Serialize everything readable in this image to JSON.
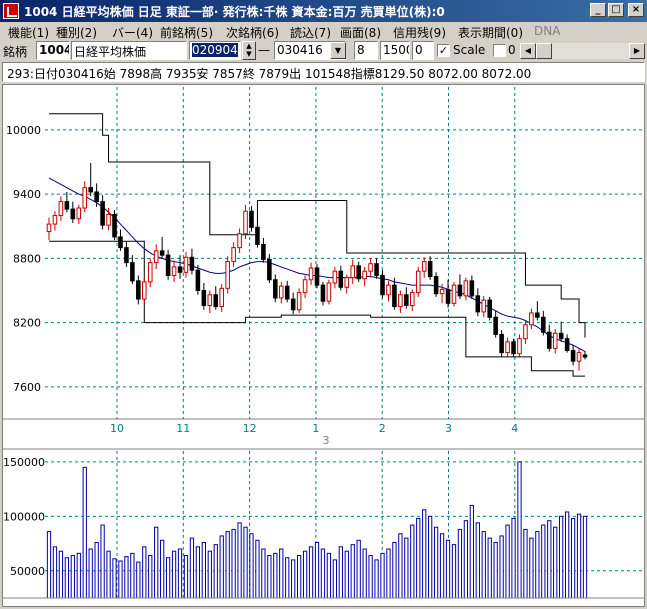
{
  "window": {
    "title": "1004 日経平均株価  日足  東証一部·  発行株:千株  資本金:百万  売買単位(株):0",
    "buttons": {
      "minimize": "_",
      "maximize": "□",
      "close": "×"
    }
  },
  "menu": [
    {
      "label": "機能(1)"
    },
    {
      "label": "種別(2)"
    },
    {
      "label": "バー(4)"
    },
    {
      "label": "前銘柄(5)"
    },
    {
      "label": "次銘柄(6)"
    },
    {
      "label": "読込(7)"
    },
    {
      "label": "画面(8)"
    },
    {
      "label": "信用残(9)"
    },
    {
      "label": "表示期間(0)"
    },
    {
      "label": "DNA",
      "disabled": true
    }
  ],
  "toolbar": {
    "symbol_label": "銘柄",
    "code_value": "1004",
    "name_value": "日経平均株価",
    "start_date": "020904",
    "dash": "—",
    "end_date": "030416",
    "period_value": "8",
    "count_value": "1500",
    "offset_value": "0",
    "scale_label": "Scale",
    "scale_checked": true,
    "extra_checked": false,
    "extra_value": "0"
  },
  "info": {
    "text": "293:日付030416始 7898高 7935安 7857終 7879出 101548指標8129.50  8072.00  8072.00"
  },
  "chart_data": {
    "type": "candlestick",
    "price_axis": {
      "ticks": [
        10000,
        9400,
        8800,
        8200,
        7600
      ],
      "ylim": [
        7300,
        10400
      ]
    },
    "volume_axis": {
      "ticks": [
        150000,
        100000,
        50000
      ],
      "ylim": [
        25000,
        160000
      ]
    },
    "x_month_labels": [
      "10",
      "11",
      "12",
      "1",
      "2",
      "3",
      "4"
    ],
    "x_year_label": "3",
    "colors": {
      "up": "#cc0000",
      "down": "#000000",
      "grid": "#008080",
      "envelope": "#000000",
      "average": "#000080",
      "volume": "#0000aa"
    },
    "candles": [
      {
        "o": 9050,
        "h": 9180,
        "l": 8970,
        "c": 9120
      },
      {
        "o": 9120,
        "h": 9240,
        "l": 9060,
        "c": 9200
      },
      {
        "o": 9200,
        "h": 9380,
        "l": 9150,
        "c": 9330
      },
      {
        "o": 9330,
        "h": 9420,
        "l": 9230,
        "c": 9260
      },
      {
        "o": 9260,
        "h": 9330,
        "l": 9130,
        "c": 9170
      },
      {
        "o": 9170,
        "h": 9300,
        "l": 9120,
        "c": 9270
      },
      {
        "o": 9270,
        "h": 9520,
        "l": 9230,
        "c": 9460
      },
      {
        "o": 9460,
        "h": 9690,
        "l": 9380,
        "c": 9420
      },
      {
        "o": 9420,
        "h": 9500,
        "l": 9280,
        "c": 9330
      },
      {
        "o": 9330,
        "h": 9390,
        "l": 9070,
        "c": 9110
      },
      {
        "o": 9110,
        "h": 9270,
        "l": 9060,
        "c": 9210
      },
      {
        "o": 9210,
        "h": 9250,
        "l": 8970,
        "c": 9000
      },
      {
        "o": 9000,
        "h": 9070,
        "l": 8870,
        "c": 8900
      },
      {
        "o": 8900,
        "h": 8960,
        "l": 8720,
        "c": 8760
      },
      {
        "o": 8760,
        "h": 8830,
        "l": 8560,
        "c": 8590
      },
      {
        "o": 8590,
        "h": 8640,
        "l": 8370,
        "c": 8420
      },
      {
        "o": 8420,
        "h": 8620,
        "l": 8380,
        "c": 8580
      },
      {
        "o": 8580,
        "h": 8800,
        "l": 8530,
        "c": 8760
      },
      {
        "o": 8760,
        "h": 8930,
        "l": 8700,
        "c": 8870
      },
      {
        "o": 8870,
        "h": 9000,
        "l": 8800,
        "c": 8830
      },
      {
        "o": 8830,
        "h": 8880,
        "l": 8600,
        "c": 8640
      },
      {
        "o": 8640,
        "h": 8780,
        "l": 8580,
        "c": 8720
      },
      {
        "o": 8720,
        "h": 8830,
        "l": 8610,
        "c": 8670
      },
      {
        "o": 8670,
        "h": 8860,
        "l": 8620,
        "c": 8810
      },
      {
        "o": 8810,
        "h": 8890,
        "l": 8650,
        "c": 8690
      },
      {
        "o": 8690,
        "h": 8740,
        "l": 8460,
        "c": 8500
      },
      {
        "o": 8500,
        "h": 8570,
        "l": 8320,
        "c": 8360
      },
      {
        "o": 8360,
        "h": 8500,
        "l": 8290,
        "c": 8460
      },
      {
        "o": 8460,
        "h": 8540,
        "l": 8320,
        "c": 8350
      },
      {
        "o": 8350,
        "h": 8560,
        "l": 8300,
        "c": 8520
      },
      {
        "o": 8520,
        "h": 8820,
        "l": 8470,
        "c": 8770
      },
      {
        "o": 8770,
        "h": 8950,
        "l": 8720,
        "c": 8900
      },
      {
        "o": 8900,
        "h": 9080,
        "l": 8850,
        "c": 9030
      },
      {
        "o": 9030,
        "h": 9300,
        "l": 8980,
        "c": 9240
      },
      {
        "o": 9240,
        "h": 9290,
        "l": 9050,
        "c": 9090
      },
      {
        "o": 9090,
        "h": 9130,
        "l": 8900,
        "c": 8930
      },
      {
        "o": 8930,
        "h": 8990,
        "l": 8760,
        "c": 8790
      },
      {
        "o": 8790,
        "h": 8840,
        "l": 8570,
        "c": 8600
      },
      {
        "o": 8600,
        "h": 8650,
        "l": 8390,
        "c": 8430
      },
      {
        "o": 8430,
        "h": 8580,
        "l": 8380,
        "c": 8540
      },
      {
        "o": 8540,
        "h": 8590,
        "l": 8390,
        "c": 8420
      },
      {
        "o": 8420,
        "h": 8480,
        "l": 8280,
        "c": 8320
      },
      {
        "o": 8320,
        "h": 8520,
        "l": 8290,
        "c": 8480
      },
      {
        "o": 8480,
        "h": 8640,
        "l": 8430,
        "c": 8600
      },
      {
        "o": 8600,
        "h": 8760,
        "l": 8550,
        "c": 8710
      },
      {
        "o": 8710,
        "h": 8750,
        "l": 8520,
        "c": 8550
      },
      {
        "o": 8550,
        "h": 8580,
        "l": 8360,
        "c": 8400
      },
      {
        "o": 8400,
        "h": 8600,
        "l": 8370,
        "c": 8570
      },
      {
        "o": 8570,
        "h": 8720,
        "l": 8520,
        "c": 8680
      },
      {
        "o": 8680,
        "h": 8730,
        "l": 8500,
        "c": 8530
      },
      {
        "o": 8530,
        "h": 8650,
        "l": 8470,
        "c": 8620
      },
      {
        "o": 8620,
        "h": 8790,
        "l": 8560,
        "c": 8730
      },
      {
        "o": 8730,
        "h": 8770,
        "l": 8580,
        "c": 8610
      },
      {
        "o": 8610,
        "h": 8720,
        "l": 8540,
        "c": 8680
      },
      {
        "o": 8680,
        "h": 8800,
        "l": 8620,
        "c": 8750
      },
      {
        "o": 8750,
        "h": 8800,
        "l": 8610,
        "c": 8640
      },
      {
        "o": 8640,
        "h": 8690,
        "l": 8430,
        "c": 8460
      },
      {
        "o": 8460,
        "h": 8590,
        "l": 8400,
        "c": 8550
      },
      {
        "o": 8550,
        "h": 8620,
        "l": 8320,
        "c": 8350
      },
      {
        "o": 8350,
        "h": 8500,
        "l": 8290,
        "c": 8460
      },
      {
        "o": 8460,
        "h": 8530,
        "l": 8330,
        "c": 8360
      },
      {
        "o": 8360,
        "h": 8510,
        "l": 8310,
        "c": 8480
      },
      {
        "o": 8480,
        "h": 8720,
        "l": 8440,
        "c": 8680
      },
      {
        "o": 8680,
        "h": 8810,
        "l": 8620,
        "c": 8770
      },
      {
        "o": 8770,
        "h": 8820,
        "l": 8600,
        "c": 8630
      },
      {
        "o": 8630,
        "h": 8670,
        "l": 8440,
        "c": 8470
      },
      {
        "o": 8470,
        "h": 8560,
        "l": 8380,
        "c": 8510
      },
      {
        "o": 8510,
        "h": 8600,
        "l": 8340,
        "c": 8380
      },
      {
        "o": 8380,
        "h": 8580,
        "l": 8350,
        "c": 8550
      },
      {
        "o": 8550,
        "h": 8650,
        "l": 8420,
        "c": 8450
      },
      {
        "o": 8450,
        "h": 8620,
        "l": 8410,
        "c": 8590
      },
      {
        "o": 8590,
        "h": 8640,
        "l": 8420,
        "c": 8450
      },
      {
        "o": 8450,
        "h": 8520,
        "l": 8260,
        "c": 8300
      },
      {
        "o": 8300,
        "h": 8450,
        "l": 8250,
        "c": 8410
      },
      {
        "o": 8410,
        "h": 8440,
        "l": 8220,
        "c": 8250
      },
      {
        "o": 8250,
        "h": 8310,
        "l": 8060,
        "c": 8090
      },
      {
        "o": 8090,
        "h": 8130,
        "l": 7880,
        "c": 7920
      },
      {
        "o": 7920,
        "h": 8060,
        "l": 7880,
        "c": 8020
      },
      {
        "o": 8020,
        "h": 8050,
        "l": 7880,
        "c": 7910
      },
      {
        "o": 7910,
        "h": 8090,
        "l": 7880,
        "c": 8050
      },
      {
        "o": 8050,
        "h": 8220,
        "l": 8000,
        "c": 8180
      },
      {
        "o": 8180,
        "h": 8330,
        "l": 8140,
        "c": 8290
      },
      {
        "o": 8290,
        "h": 8400,
        "l": 8220,
        "c": 8250
      },
      {
        "o": 8250,
        "h": 8310,
        "l": 8080,
        "c": 8110
      },
      {
        "o": 8110,
        "h": 8180,
        "l": 7930,
        "c": 7960
      },
      {
        "o": 7960,
        "h": 8140,
        "l": 7910,
        "c": 8100
      },
      {
        "o": 8100,
        "h": 8210,
        "l": 8020,
        "c": 8050
      },
      {
        "o": 8050,
        "h": 8090,
        "l": 7920,
        "c": 7940
      },
      {
        "o": 7940,
        "h": 7990,
        "l": 7800,
        "c": 7840
      },
      {
        "o": 7840,
        "h": 7960,
        "l": 7750,
        "c": 7920
      },
      {
        "o": 7898,
        "h": 7935,
        "l": 7857,
        "c": 7879
      }
    ],
    "volumes": [
      86000,
      72000,
      68000,
      62000,
      64000,
      66000,
      145000,
      70000,
      76000,
      92000,
      68000,
      61000,
      59000,
      63000,
      66000,
      58000,
      72000,
      64000,
      90000,
      78000,
      62000,
      68000,
      70000,
      64000,
      80000,
      72000,
      76000,
      68000,
      74000,
      82000,
      86000,
      88000,
      94000,
      90000,
      84000,
      78000,
      70000,
      64000,
      66000,
      70000,
      62000,
      60000,
      64000,
      68000,
      72000,
      76000,
      70000,
      66000,
      60000,
      72000,
      68000,
      74000,
      78000,
      70000,
      64000,
      60000,
      66000,
      70000,
      76000,
      84000,
      80000,
      92000,
      98000,
      106000,
      100000,
      90000,
      84000,
      78000,
      74000,
      88000,
      96000,
      110000,
      94000,
      86000,
      80000,
      76000,
      82000,
      92000,
      98000,
      150000,
      88000,
      80000,
      86000,
      92000,
      96000,
      90000,
      100000,
      104000,
      98000,
      102000,
      100000
    ],
    "upper_envelope": [
      10150,
      10150,
      10150,
      10150,
      10150,
      10150,
      10150,
      10150,
      10150,
      9950,
      9700,
      9700,
      9700,
      9700,
      9700,
      9700,
      9700,
      9700,
      9700,
      9700,
      9700,
      9700,
      9700,
      9700,
      9700,
      9700,
      9700,
      9020,
      9020,
      9020,
      9020,
      9020,
      9020,
      9020,
      9020,
      9340,
      9340,
      9340,
      9340,
      9340,
      9340,
      9340,
      9340,
      9340,
      9340,
      9340,
      9340,
      9340,
      9340,
      9340,
      8850,
      8850,
      8850,
      8850,
      8850,
      8850,
      8850,
      8850,
      8850,
      8850,
      8850,
      8850,
      8850,
      8850,
      8850,
      8850,
      8850,
      8850,
      8850,
      8850,
      8850,
      8850,
      8850,
      8850,
      8850,
      8850,
      8850,
      8850,
      8850,
      8850,
      8550,
      8550,
      8550,
      8550,
      8550,
      8550,
      8420,
      8420,
      8420,
      8200,
      8060
    ],
    "lower_envelope": [
      8960,
      8960,
      8960,
      8960,
      8960,
      8960,
      8960,
      8960,
      8960,
      8960,
      8960,
      8960,
      8960,
      8960,
      8960,
      8960,
      8200,
      8200,
      8200,
      8200,
      8200,
      8200,
      8200,
      8200,
      8200,
      8200,
      8200,
      8200,
      8200,
      8200,
      8200,
      8200,
      8200,
      8250,
      8250,
      8250,
      8250,
      8250,
      8250,
      8270,
      8270,
      8270,
      8270,
      8270,
      8270,
      8270,
      8270,
      8270,
      8270,
      8270,
      8270,
      8270,
      8270,
      8270,
      8250,
      8250,
      8250,
      8250,
      8250,
      8250,
      8250,
      8250,
      8250,
      8250,
      8250,
      8250,
      8250,
      8250,
      8250,
      8250,
      7880,
      7880,
      7880,
      7880,
      7880,
      7880,
      7880,
      7880,
      7880,
      7880,
      7880,
      7750,
      7750,
      7750,
      7750,
      7750,
      7750,
      7750,
      7700,
      7700,
      7700
    ],
    "average_line": [
      9550,
      9520,
      9490,
      9460,
      9430,
      9400,
      9380,
      9350,
      9320,
      9280,
      9230,
      9180,
      9120,
      9060,
      9000,
      8940,
      8890,
      8850,
      8820,
      8800,
      8780,
      8770,
      8760,
      8750,
      8730,
      8710,
      8690,
      8670,
      8660,
      8660,
      8670,
      8690,
      8720,
      8740,
      8760,
      8770,
      8770,
      8760,
      8740,
      8720,
      8700,
      8680,
      8660,
      8650,
      8640,
      8640,
      8630,
      8620,
      8620,
      8620,
      8620,
      8620,
      8620,
      8630,
      8630,
      8620,
      8610,
      8600,
      8580,
      8570,
      8560,
      8550,
      8550,
      8550,
      8550,
      8540,
      8530,
      8510,
      8490,
      8480,
      8460,
      8430,
      8400,
      8370,
      8340,
      8310,
      8280,
      8260,
      8250,
      8240,
      8220,
      8190,
      8160,
      8120,
      8080,
      8050,
      8030,
      8010,
      7990,
      7960,
      7930
    ]
  }
}
